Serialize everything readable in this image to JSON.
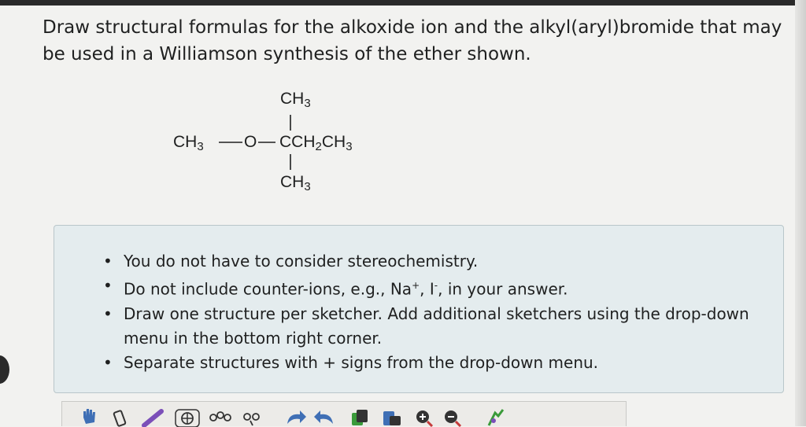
{
  "question": {
    "text": "Draw structural formulas for the alkoxide ion and the alkyl(aryl)bromide that may be used in a Williamson synthesis of the ether shown."
  },
  "structure": {
    "top_group": "CH",
    "top_sub": "3",
    "left_group": "CH",
    "left_sub": "3",
    "oxygen": "O",
    "center_c": "C",
    "center_ch": "CH",
    "center_sub1": "2",
    "center_ch2": "CH",
    "center_sub2": "3",
    "bottom_group": "CH",
    "bottom_sub": "3"
  },
  "instructions": {
    "item1": "You do not have to consider stereochemistry.",
    "item2_a": "Do not include counter-ions, e.g., Na",
    "item2_sup1": "+",
    "item2_b": ", I",
    "item2_sup2": "-",
    "item2_c": ", in your answer.",
    "item3": "Draw one structure per sketcher. Add additional sketchers using the drop-down menu in the bottom right corner.",
    "item4": "Separate structures with + signs from the drop-down menu."
  },
  "toolbar": {
    "icons": [
      "hand-icon",
      "eraser-icon",
      "pencil-bond-icon",
      "ring-template-icon",
      "chain-template-icon",
      "charge-template-icon",
      "undo-icon",
      "redo-icon",
      "copy-icon",
      "paste-icon",
      "zoom-in-icon",
      "zoom-out-icon",
      "settings-icon"
    ],
    "colors": {
      "blue": "#3f6fb5",
      "purple": "#7b4fb8",
      "dark": "#333333",
      "green": "#3a9a3a",
      "red": "#c43a3a"
    }
  }
}
